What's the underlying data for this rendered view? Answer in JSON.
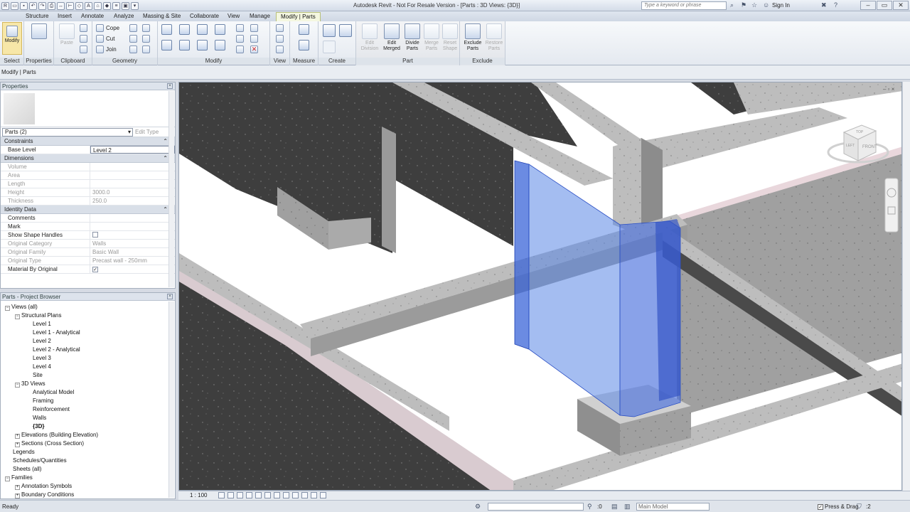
{
  "app": {
    "title": "Autodesk Revit - Not For Resale Version - [Parts : 3D Views: {3D}]",
    "search_placeholder": "Type a keyword or phrase",
    "sign_in": "Sign In"
  },
  "tabs": [
    "Structure",
    "Insert",
    "Annotate",
    "Analyze",
    "Massing & Site",
    "Collaborate",
    "View",
    "Manage",
    "Modify | Parts"
  ],
  "active_tab": "Modify | Parts",
  "ribbon": {
    "panels": {
      "select": "Select",
      "properties": "Properties",
      "clipboard": "Clipboard",
      "geometry": "Geometry",
      "modify": "Modify",
      "view": "View",
      "measure": "Measure",
      "create": "Create",
      "part": "Part",
      "exclude": "Exclude"
    },
    "modify_btn": "Modify",
    "paste_btn": "Paste",
    "cope": "Cope",
    "cut": "Cut",
    "join": "Join",
    "part_buttons": [
      {
        "label1": "Edit",
        "label2": "Division",
        "enabled": false
      },
      {
        "label1": "Edit",
        "label2": "Merged",
        "enabled": true
      },
      {
        "label1": "Divide",
        "label2": "Parts",
        "enabled": true
      },
      {
        "label1": "Merge",
        "label2": "Parts",
        "enabled": false
      },
      {
        "label1": "Reset",
        "label2": "Shape",
        "enabled": false
      }
    ],
    "exclude_buttons": [
      {
        "label1": "Exclude",
        "label2": "Parts",
        "enabled": true
      },
      {
        "label1": "Restore",
        "label2": "Parts",
        "enabled": false
      }
    ]
  },
  "context_bar": "Modify | Parts",
  "properties": {
    "title": "Properties",
    "type_selector": "Parts (2)",
    "edit_type": "Edit Type",
    "groups": [
      {
        "name": "Constraints",
        "rows": [
          {
            "k": "Base Level",
            "v": "Level 2",
            "grey": false,
            "editing": true
          }
        ]
      },
      {
        "name": "Dimensions",
        "rows": [
          {
            "k": "Volume",
            "v": "",
            "grey": true
          },
          {
            "k": "Area",
            "v": "",
            "grey": true
          },
          {
            "k": "Length",
            "v": "",
            "grey": true
          },
          {
            "k": "Height",
            "v": "3000.0",
            "grey": true
          },
          {
            "k": "Thickness",
            "v": "250.0",
            "grey": true
          }
        ]
      },
      {
        "name": "Identity Data",
        "rows": [
          {
            "k": "Comments",
            "v": "",
            "grey": false
          },
          {
            "k": "Mark",
            "v": "",
            "grey": false
          },
          {
            "k": "Show Shape Handles",
            "v": "",
            "grey": false,
            "check": ""
          },
          {
            "k": "Original Category",
            "v": "Walls",
            "grey": true
          },
          {
            "k": "Original Family",
            "v": "Basic Wall",
            "grey": true
          },
          {
            "k": "Original Type",
            "v": "Precast wall - 250mm",
            "grey": true
          },
          {
            "k": "Material By Original",
            "v": "",
            "grey": false,
            "check": "✓"
          }
        ]
      }
    ]
  },
  "browser": {
    "title": "Parts - Project Browser",
    "items": [
      {
        "label": "Views (all)",
        "depth": 0,
        "toggle": "−",
        "bold": false
      },
      {
        "label": "Structural Plans",
        "depth": 1,
        "toggle": "−",
        "bold": false
      },
      {
        "label": "Level 1",
        "depth": 2,
        "toggle": "",
        "bold": false
      },
      {
        "label": "Level 1 - Analytical",
        "depth": 2,
        "toggle": "",
        "bold": false
      },
      {
        "label": "Level 2",
        "depth": 2,
        "toggle": "",
        "bold": false
      },
      {
        "label": "Level 2 - Analytical",
        "depth": 2,
        "toggle": "",
        "bold": false
      },
      {
        "label": "Level 3",
        "depth": 2,
        "toggle": "",
        "bold": false
      },
      {
        "label": "Level 4",
        "depth": 2,
        "toggle": "",
        "bold": false
      },
      {
        "label": "Site",
        "depth": 2,
        "toggle": "",
        "bold": false
      },
      {
        "label": "3D Views",
        "depth": 1,
        "toggle": "−",
        "bold": false
      },
      {
        "label": "Analytical Model",
        "depth": 2,
        "toggle": "",
        "bold": false
      },
      {
        "label": "Framing",
        "depth": 2,
        "toggle": "",
        "bold": false
      },
      {
        "label": "Reinforcement",
        "depth": 2,
        "toggle": "",
        "bold": false
      },
      {
        "label": "Walls",
        "depth": 2,
        "toggle": "",
        "bold": false
      },
      {
        "label": "{3D}",
        "depth": 2,
        "toggle": "",
        "bold": true
      },
      {
        "label": "Elevations (Building Elevation)",
        "depth": 1,
        "toggle": "+",
        "bold": false
      },
      {
        "label": "Sections (Cross Section)",
        "depth": 1,
        "toggle": "+",
        "bold": false
      },
      {
        "label": "Legends",
        "depth": 0,
        "toggle": "",
        "bold": false
      },
      {
        "label": "Schedules/Quantities",
        "depth": 0,
        "toggle": "",
        "bold": false
      },
      {
        "label": "Sheets (all)",
        "depth": 0,
        "toggle": "",
        "bold": false
      },
      {
        "label": "Families",
        "depth": 0,
        "toggle": "−",
        "bold": false
      },
      {
        "label": "Annotation Symbols",
        "depth": 1,
        "toggle": "+",
        "bold": false
      },
      {
        "label": "Boundary Conditions",
        "depth": 1,
        "toggle": "+",
        "bold": false
      }
    ]
  },
  "viewport": {
    "scale": "1 : 100",
    "viewcube_front": "FRONT",
    "viewcube_left": "LEFT",
    "viewcube_top": "TOP"
  },
  "status": {
    "text": "Ready",
    "ctrl_value": ":0",
    "design_option": "Main Model",
    "press_drag": "Press & Drag",
    "filter_count": ":2"
  },
  "colors": {
    "selection": "#4a78e8",
    "concrete": "#b9b9b9",
    "dark_wall": "#404040"
  }
}
